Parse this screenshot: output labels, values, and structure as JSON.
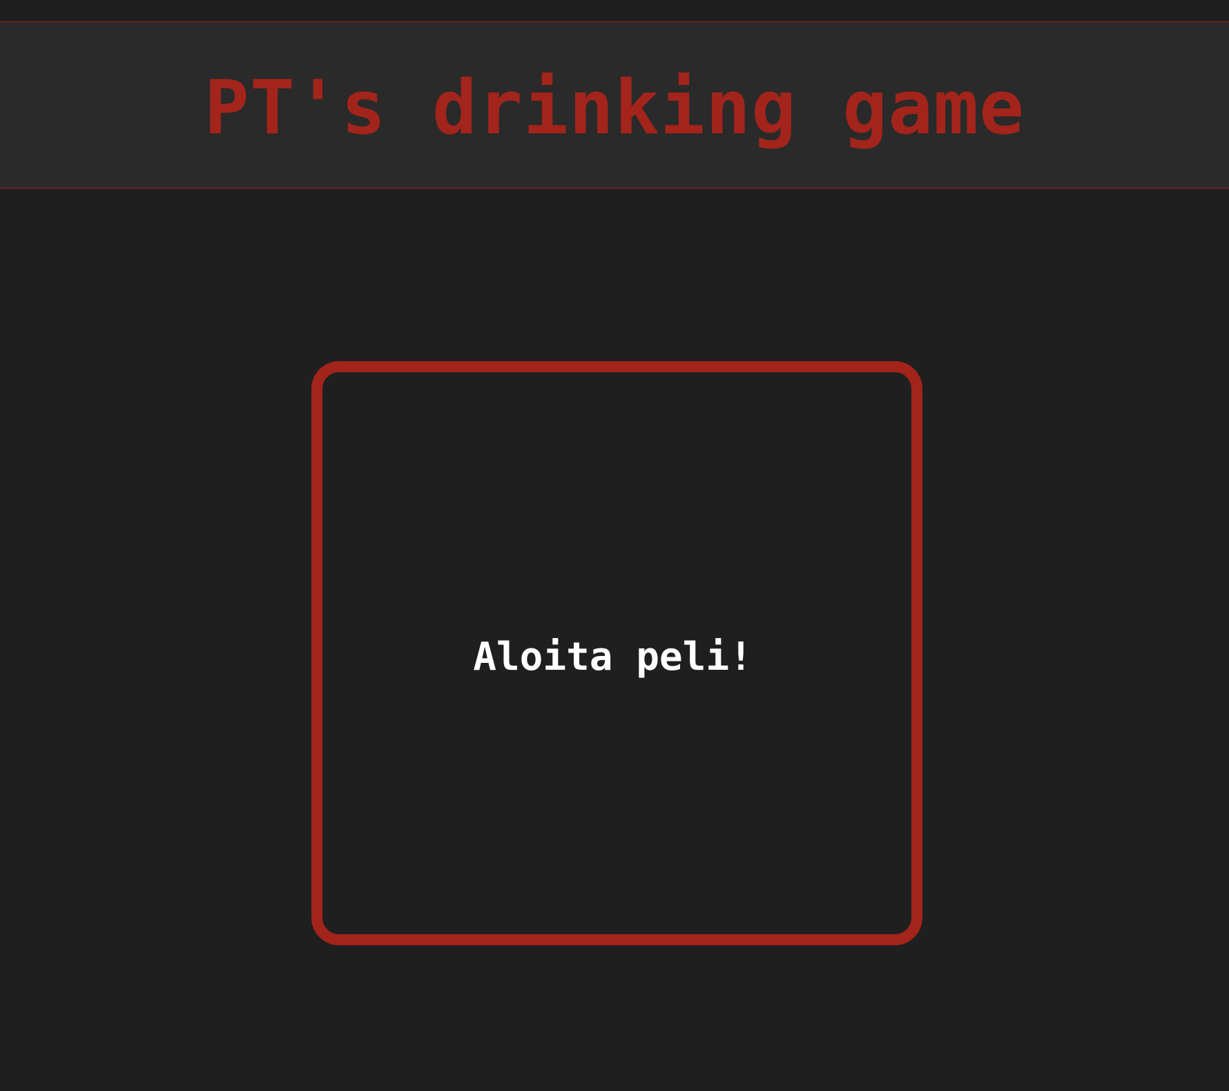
{
  "header": {
    "title": "PT's drinking game"
  },
  "card": {
    "label": "Aloita peli!"
  },
  "colors": {
    "background": "#1f1f1f",
    "header_background": "#2a2a2a",
    "accent": "#a3241b",
    "card_text": "#ffffff"
  }
}
